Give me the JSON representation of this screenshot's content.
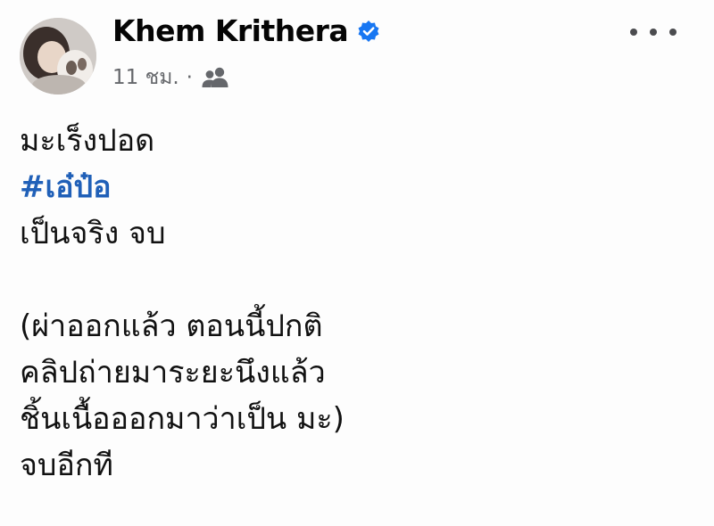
{
  "post": {
    "author_name": "Khem Krithera",
    "timestamp": "11 ชม.",
    "separator": "·",
    "audience_icon": "friends-icon",
    "verified_icon": "verified-badge-icon",
    "more_icon": "more-options-icon",
    "body": {
      "line1": "มะเร็งปอด",
      "hashtag": "#เอ๋ป๋อ",
      "line3": "เป็นจริง จบ",
      "line5": "(ผ่าออกแล้ว ตอนนี้ปกติ",
      "line6": "คลิปถ่ายมาระยะนึงแล้ว",
      "line7": "ชิ้นเนื้อออกมาว่าเป็น มะ)",
      "line8": "จบอีกที"
    }
  },
  "colors": {
    "verified": "#1877f2",
    "hashtag": "#2060b8",
    "meta": "#65676b"
  }
}
